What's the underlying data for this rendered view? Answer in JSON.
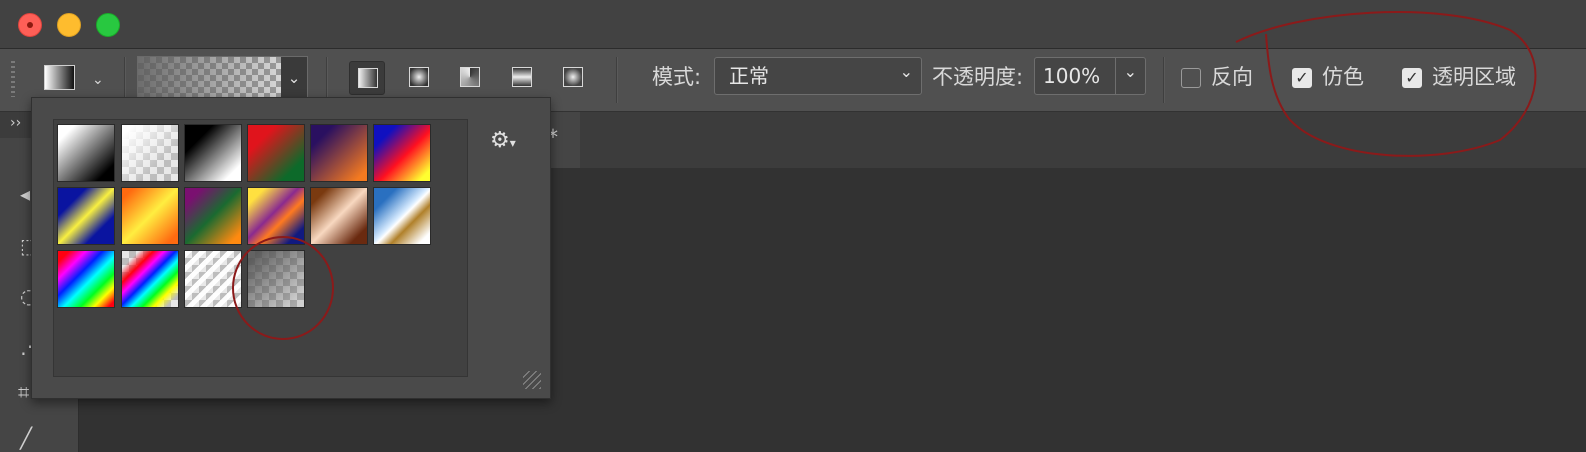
{
  "titlebar": {
    "buttons": [
      "close",
      "minimize",
      "maximize"
    ]
  },
  "options_bar": {
    "mode_label": "模式:",
    "mode_value": "正常",
    "opacity_label": "不透明度:",
    "opacity_value": "100%",
    "reverse_label": "反向",
    "reverse_checked": false,
    "dither_label": "仿色",
    "dither_checked": true,
    "transparency_label": "透明区域",
    "transparency_checked": true,
    "gradient_types": [
      "linear",
      "radial",
      "angle",
      "reflected",
      "diamond"
    ],
    "active_gradient_type": "linear"
  },
  "document_tab": {
    "label": "*"
  },
  "gradient_picker": {
    "settings_icon": "gear-icon",
    "presets": [
      "black-white",
      "white-transparent",
      "black-white-reverse",
      "red-green",
      "violet-orange",
      "blue-red-yellow",
      "blue-yellow-blue",
      "orange-yellow-orange",
      "violet-green-orange",
      "yellow-violet-orange-blue",
      "copper",
      "chrome",
      "spectrum",
      "transparent-rainbow",
      "transparent-stripes",
      "foreground-transparent"
    ],
    "selected_preset": "foreground-transparent"
  },
  "colors": {
    "accent_annotation": "#8b1a1a",
    "toolbar_bg": "#505050",
    "canvas_bg": "#323232"
  }
}
